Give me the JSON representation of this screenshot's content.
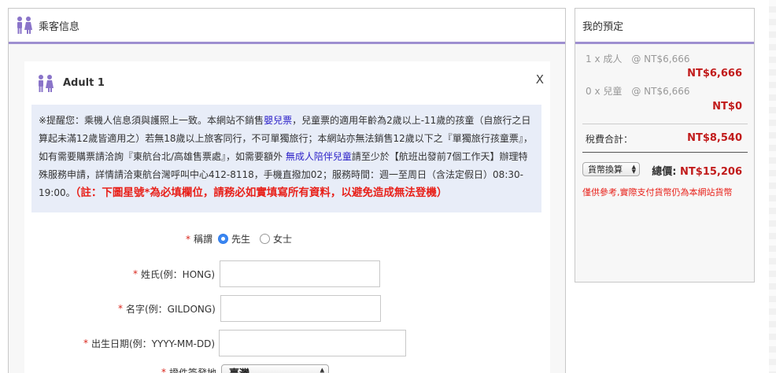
{
  "passenger": {
    "section_title": "乘客信息",
    "card_title": "Adult 1",
    "close": "X",
    "notice": {
      "p1": "※提醒您：乘機人信息須與護照上一致。本網站不銷售",
      "infant_link": "嬰兒票",
      "p2": "，兒童票的適用年齡為2歲以上-11歲的孩童（自旅行之日算起未滿12歲皆適用之）若無18歲以上旅客同行，不可單獨旅行；本網站亦無法銷售12歲以下之『單獨旅行孩童票』，如有需要購票請洽詢『東航台北/高雄售票處』，如需要額外 ",
      "unaccompanied_link": "無成人陪伴兒童",
      "p3": "請至少於【航班出發前7個工作天】辦理特殊服務申請，詳情請洽東航台灣呼叫中心412-8118，手機直撥加02；服務時間：週一至周日（含法定假日）08:30-19:00。",
      "warning": "（註：下圖星號*為必填欄位，請務必如實填寫所有資料，以避免造成無法登機）"
    },
    "form": {
      "required_mark": "*",
      "title_label": "稱謂",
      "title_options": [
        "先生",
        "女士"
      ],
      "title_selected": "先生",
      "surname_label": "姓氏(例：HONG)",
      "surname_value": "",
      "given_label": "名字(例：GILDONG)",
      "given_value": "",
      "dob_label": "出生日期(例：YYYY-MM-DD)",
      "dob_value": "",
      "issue_label": "證件簽發地",
      "issue_value": "臺灣"
    }
  },
  "booking": {
    "title": "我的預定",
    "adult_line": "1 x 成人　@ NT$6,666",
    "adult_total": "NT$6,666",
    "child_line": "0 x 兒童　@ NT$6,666",
    "child_total": "NT$0",
    "tax_label": "稅費合計：",
    "tax_total": "NT$8,540",
    "currency_label": "貨幣換算",
    "grand_label": "總價: ",
    "grand_total": "NT$15,206",
    "note": "僅供參考,實際支付貨幣仍為本網站貨幣"
  },
  "colors": {
    "accent": "#9e8fd0",
    "price": "#c11b1b",
    "link": "#2f24c9",
    "warning": "#e8211a"
  }
}
